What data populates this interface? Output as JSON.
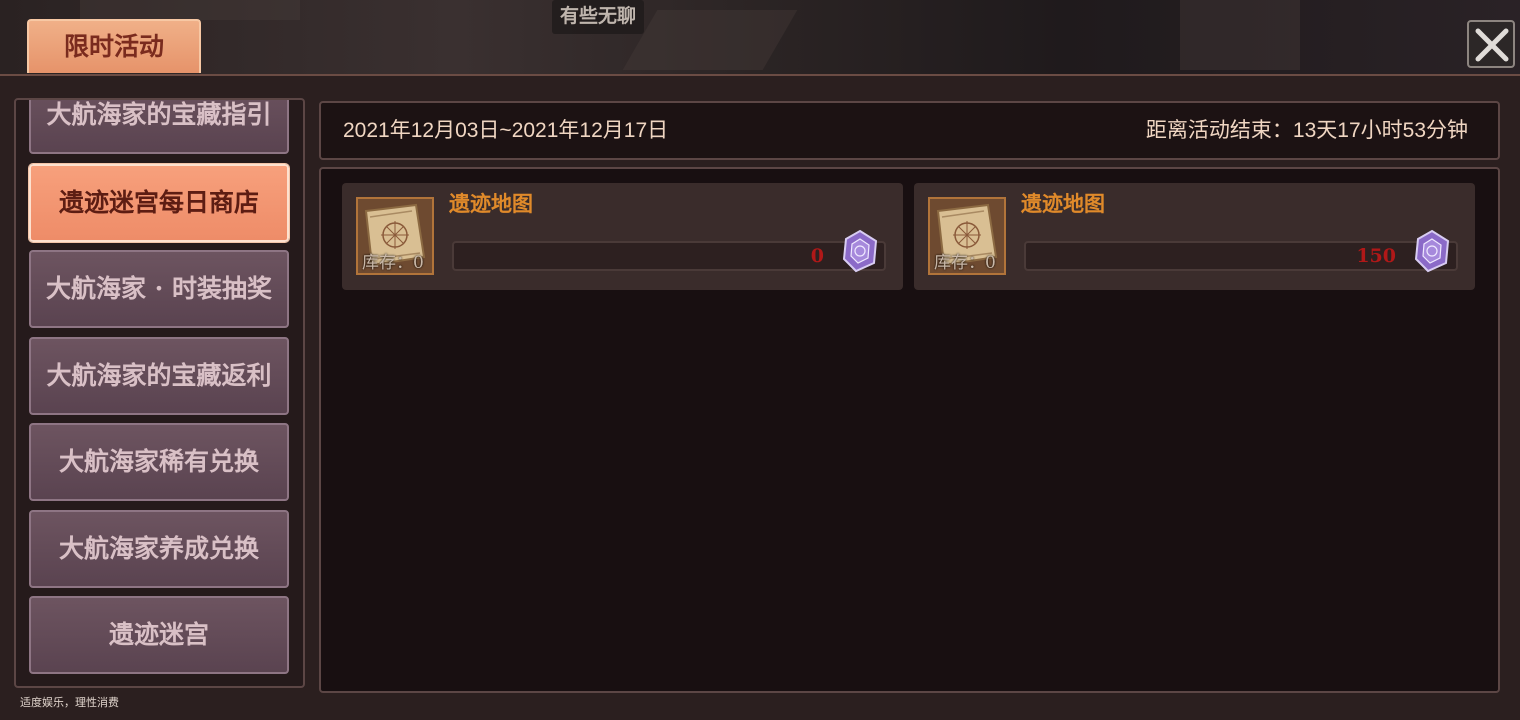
{
  "scene": {
    "floating_text": "有些无聊"
  },
  "header": {
    "title": "限时活动",
    "close_icon": "close-icon"
  },
  "sidebar": {
    "items": [
      {
        "label": "大航海家的宝藏指引",
        "active": false
      },
      {
        "label": "遗迹迷宫每日商店",
        "active": true
      },
      {
        "label": "大航海家 · 时装抽奖",
        "active": false
      },
      {
        "label": "大航海家的宝藏返利",
        "active": false
      },
      {
        "label": "大航海家稀有兑换",
        "active": false
      },
      {
        "label": "大航海家养成兑换",
        "active": false
      },
      {
        "label": "遗迹迷宫",
        "active": false
      }
    ]
  },
  "footer_note": "适度娱乐，理性消费",
  "activity": {
    "date_range": "2021年12月03日~2021年12月17日",
    "countdown": "距离活动结束：13天17小时53分钟"
  },
  "shop": {
    "items": [
      {
        "name": "遗迹地图",
        "stock_label": "库存：",
        "stock_value": "0",
        "price": "0",
        "icon": "treasure-map-icon",
        "currency_icon": "purple-gem-icon"
      },
      {
        "name": "遗迹地图",
        "stock_label": "库存：",
        "stock_value": "0",
        "price": "150",
        "icon": "treasure-map-icon",
        "currency_icon": "purple-gem-icon"
      }
    ]
  },
  "colors": {
    "active_tab": "#ee8c68",
    "inactive_tab": "#5a4350",
    "item_name": "#e08a2a",
    "price": "#b01818"
  }
}
